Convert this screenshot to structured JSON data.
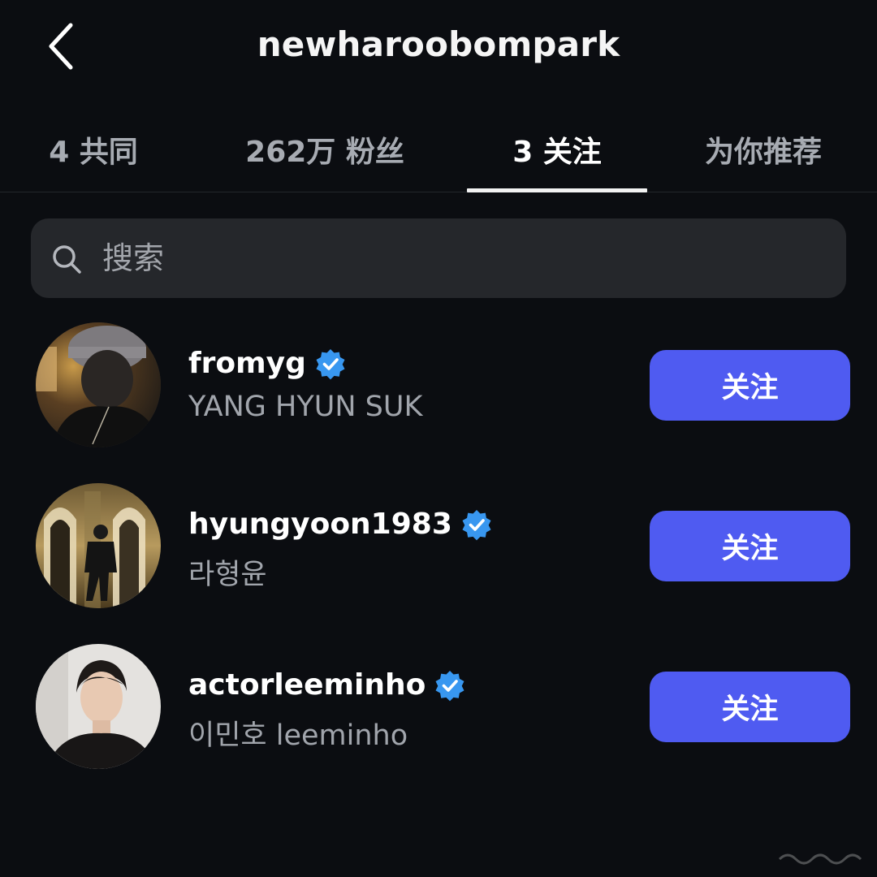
{
  "header": {
    "back_icon": "chevron-left-icon",
    "title": "newharoobompark"
  },
  "tabs": [
    {
      "label": "4 共同",
      "active": false
    },
    {
      "label": "262万 粉丝",
      "active": false
    },
    {
      "label": "3 关注",
      "active": true
    },
    {
      "label": "为你推荐",
      "active": false
    }
  ],
  "search": {
    "icon": "search-icon",
    "placeholder": "搜索",
    "value": ""
  },
  "following": [
    {
      "username": "fromyg",
      "verified": true,
      "full_name": "YANG HYUN SUK",
      "button_label": "关注"
    },
    {
      "username": "hyungyoon1983",
      "verified": true,
      "full_name": "라형윤",
      "button_label": "关注"
    },
    {
      "username": "actorleeminho",
      "verified": true,
      "full_name": "이민호 leeminho",
      "button_label": "关注"
    }
  ],
  "colors": {
    "background": "#0b0d11",
    "follow_button": "#4f5bf1",
    "verified_badge": "#3897f0",
    "secondary_text": "#a1a5ac"
  }
}
